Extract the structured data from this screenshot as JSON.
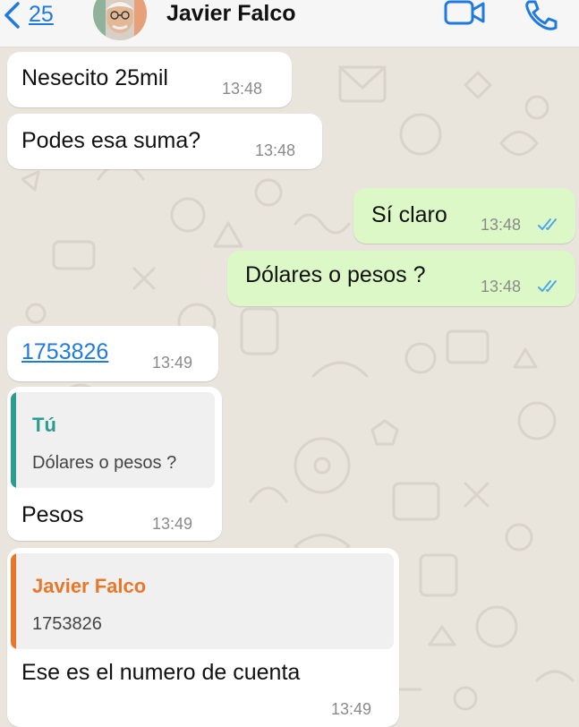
{
  "header": {
    "back_count": "25",
    "contact_name": "Javier Falco"
  },
  "messages": [
    {
      "direction": "in",
      "text": "Nesecito 25mil",
      "time": "13:48"
    },
    {
      "direction": "in",
      "text": "Podes esa suma?",
      "time": "13:48"
    },
    {
      "direction": "out",
      "text": "Sí claro",
      "time": "13:48",
      "status": "read"
    },
    {
      "direction": "out",
      "text": "Dólares o pesos ?",
      "time": "13:48",
      "status": "read"
    },
    {
      "direction": "in",
      "text": "1753826",
      "time": "13:49",
      "is_link": true
    },
    {
      "direction": "in",
      "text": "Pesos",
      "time": "13:49",
      "quote": {
        "author": "Tú",
        "text": "Dólares o pesos ?"
      }
    },
    {
      "direction": "in",
      "text": "Ese es el numero de cuenta",
      "time": "13:49",
      "quote": {
        "author": "Javier Falco",
        "text": "1753826"
      }
    }
  ],
  "colors": {
    "accent_blue": "#1f7ae0",
    "outgoing_bubble": "#dcf8c6",
    "incoming_bubble": "#ffffff",
    "read_ticks": "#4fa6e8",
    "quote_self": "#2a9d8f",
    "quote_contact": "#e8772a"
  }
}
